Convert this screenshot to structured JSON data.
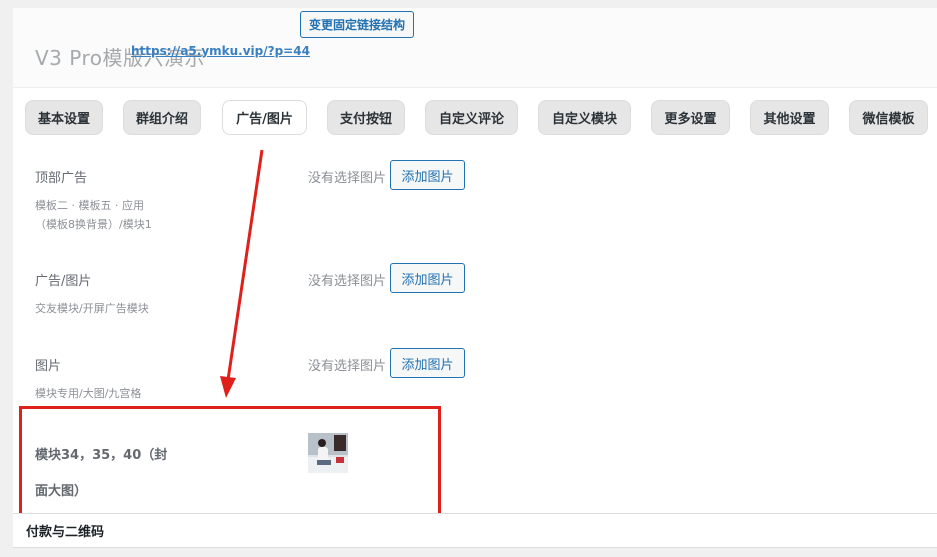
{
  "header": {
    "site_title": "V3 Pro模版六演示",
    "permalink": "https://a5.ymku.vip/?p=44",
    "change_permalink_label": "变更固定链接结构"
  },
  "tabs": [
    {
      "label": "基本设置"
    },
    {
      "label": "群组介绍"
    },
    {
      "label": "广告/图片"
    },
    {
      "label": "支付按钮"
    },
    {
      "label": "自定义评论"
    },
    {
      "label": "自定义模块"
    },
    {
      "label": "更多设置"
    },
    {
      "label": "其他设置"
    },
    {
      "label": "微信模板"
    }
  ],
  "active_tab": "广告/图片",
  "fields": [
    {
      "label": "顶部广告",
      "desc_lines": [
        "模板二 · 模板五 · 应用",
        "（模板8换背景）/模块1"
      ],
      "status": "没有选择图片",
      "button": "添加图片"
    },
    {
      "label": "广告/图片",
      "desc_lines": [
        "交友模块/开屏广告模块"
      ],
      "status": "没有选择图片",
      "button": "添加图片"
    },
    {
      "label": "图片",
      "desc_lines": [
        "模块专用/大图/九宫格"
      ],
      "status": "没有选择图片",
      "button": "添加图片"
    }
  ],
  "cover_field": {
    "label": "模块34，35，40（封面大图）"
  },
  "payment_section": {
    "title": "付款与二维码"
  },
  "colors": {
    "accent": "#2271b1",
    "annotation_red": "#e0201b"
  }
}
